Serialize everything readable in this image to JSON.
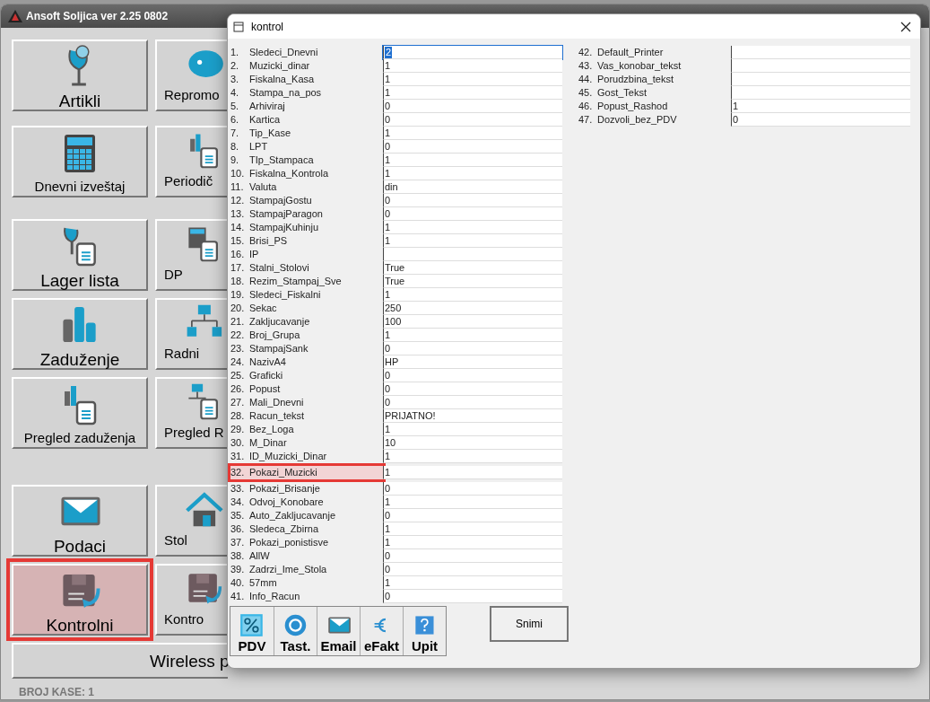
{
  "main_window": {
    "title": "Ansoft Soljica ver 2.25 0802",
    "buttons": [
      {
        "label": "Artikli",
        "highlighted": false
      },
      {
        "label": "Repromo",
        "highlighted": false
      },
      {
        "label": "Dnevni izveštaj",
        "highlighted": false
      },
      {
        "label": "Periodič",
        "highlighted": false
      },
      {
        "label": "Lager lista",
        "highlighted": false
      },
      {
        "label": "DP",
        "highlighted": false
      },
      {
        "label": "Zaduženje",
        "highlighted": false
      },
      {
        "label": "Radni",
        "highlighted": false
      },
      {
        "label": "Pregled zaduženja",
        "highlighted": false
      },
      {
        "label": "Pregled R",
        "highlighted": false
      },
      {
        "label": "Podaci",
        "highlighted": false
      },
      {
        "label": "Stol",
        "highlighted": false
      },
      {
        "label": "Kontrolni",
        "highlighted": true
      },
      {
        "label": "Kontro",
        "highlighted": false
      }
    ],
    "wide_button": "Wireless p",
    "status": "BROJ KASE: 1"
  },
  "dialog": {
    "title": "kontrol",
    "columns": [
      [
        {
          "number": "1.",
          "name": "Sledeci_Dnevni",
          "value": "2",
          "selected": true,
          "highlighted": false
        },
        {
          "number": "2.",
          "name": "Muzicki_dinar",
          "value": "1",
          "selected": false,
          "highlighted": false
        },
        {
          "number": "3.",
          "name": "Fiskalna_Kasa",
          "value": "1",
          "selected": false,
          "highlighted": false
        },
        {
          "number": "4.",
          "name": "Stampa_na_pos",
          "value": "1",
          "selected": false,
          "highlighted": false
        },
        {
          "number": "5.",
          "name": "Arhiviraj",
          "value": "0",
          "selected": false,
          "highlighted": false
        },
        {
          "number": "6.",
          "name": "Kartica",
          "value": "0",
          "selected": false,
          "highlighted": false
        },
        {
          "number": "7.",
          "name": "Tip_Kase",
          "value": "1",
          "selected": false,
          "highlighted": false
        },
        {
          "number": "8.",
          "name": "LPT",
          "value": "0",
          "selected": false,
          "highlighted": false
        },
        {
          "number": "9.",
          "name": "TIp_Stampaca",
          "value": "1",
          "selected": false,
          "highlighted": false
        },
        {
          "number": "10.",
          "name": "Fiskalna_Kontrola",
          "value": "1",
          "selected": false,
          "highlighted": false
        },
        {
          "number": "11.",
          "name": "Valuta",
          "value": "din",
          "selected": false,
          "highlighted": false
        },
        {
          "number": "12.",
          "name": "StampajGostu",
          "value": "0",
          "selected": false,
          "highlighted": false
        },
        {
          "number": "13.",
          "name": "StampajParagon",
          "value": "0",
          "selected": false,
          "highlighted": false
        },
        {
          "number": "14.",
          "name": "StampajKuhinju",
          "value": "1",
          "selected": false,
          "highlighted": false
        },
        {
          "number": "15.",
          "name": "Brisi_PS",
          "value": "1",
          "selected": false,
          "highlighted": false
        },
        {
          "number": "16.",
          "name": "IP",
          "selected": false,
          "highlighted": false
        },
        {
          "number": "17.",
          "name": "Stalni_Stolovi",
          "value": "True",
          "selected": false,
          "highlighted": false
        },
        {
          "number": "18.",
          "name": "Rezim_Stampaj_Sve",
          "value": "True",
          "selected": false,
          "highlighted": false
        },
        {
          "number": "19.",
          "name": "Sledeci_Fiskalni",
          "value": "1",
          "selected": false,
          "highlighted": false
        },
        {
          "number": "20.",
          "name": "Sekac",
          "value": "250",
          "selected": false,
          "highlighted": false
        },
        {
          "number": "21.",
          "name": "Zakljucavanje",
          "value": "100",
          "selected": false,
          "highlighted": false
        },
        {
          "number": "22.",
          "name": "Broj_Grupa",
          "value": "1",
          "selected": false,
          "highlighted": false
        },
        {
          "number": "23.",
          "name": "StampajSank",
          "value": "0",
          "selected": false,
          "highlighted": false
        },
        {
          "number": "24.",
          "name": "NazivA4",
          "value": "HP",
          "selected": false,
          "highlighted": false
        },
        {
          "number": "25.",
          "name": "Graficki",
          "value": "0",
          "selected": false,
          "highlighted": false
        },
        {
          "number": "26.",
          "name": "Popust",
          "value": "0",
          "selected": false,
          "highlighted": false
        },
        {
          "number": "27.",
          "name": "Mali_Dnevni",
          "value": "0",
          "selected": false,
          "highlighted": false
        },
        {
          "number": "28.",
          "name": "Racun_tekst",
          "value": "PRIJATNO!",
          "selected": false,
          "highlighted": false
        },
        {
          "number": "29.",
          "name": "Bez_Loga",
          "value": "1",
          "selected": false,
          "highlighted": false
        },
        {
          "number": "30.",
          "name": "M_Dinar",
          "value": "10",
          "selected": false,
          "highlighted": false
        },
        {
          "number": "31.",
          "name": "ID_Muzicki_Dinar",
          "value": "1",
          "selected": false,
          "highlighted": false
        },
        {
          "number": "32.",
          "name": "Pokazi_Muzicki",
          "value": "1",
          "selected": false,
          "highlighted": true
        },
        {
          "number": "33.",
          "name": "Pokazi_Brisanje",
          "value": "0",
          "selected": false,
          "highlighted": false
        },
        {
          "number": "34.",
          "name": "Odvoj_Konobare",
          "value": "1",
          "selected": false,
          "highlighted": false
        },
        {
          "number": "35.",
          "name": "Auto_Zakljucavanje",
          "value": "0",
          "selected": false,
          "highlighted": false
        },
        {
          "number": "36.",
          "name": "Sledeca_Zbirna",
          "value": "1",
          "selected": false,
          "highlighted": false
        },
        {
          "number": "37.",
          "name": "Pokazi_ponistisve",
          "value": "1",
          "selected": false,
          "highlighted": false
        },
        {
          "number": "38.",
          "name": "AllW",
          "value": "0",
          "selected": false,
          "highlighted": false
        },
        {
          "number": "39.",
          "name": "Zadrzi_Ime_Stola",
          "value": "0",
          "selected": false,
          "highlighted": false
        },
        {
          "number": "40.",
          "name": "57mm",
          "value": "1",
          "selected": false,
          "highlighted": false
        },
        {
          "number": "41.",
          "name": "Info_Racun",
          "value": "0",
          "selected": false,
          "highlighted": false
        }
      ],
      [
        {
          "number": "42.",
          "name": "Default_Printer",
          "selected": false,
          "highlighted": false
        },
        {
          "number": "43.",
          "name": "Vas_konobar_tekst",
          "selected": false,
          "highlighted": false
        },
        {
          "number": "44.",
          "name": "Porudzbina_tekst",
          "selected": false,
          "highlighted": false
        },
        {
          "number": "45.",
          "name": "Gost_Tekst",
          "selected": false,
          "highlighted": false
        },
        {
          "number": "46.",
          "name": "Popust_Rashod",
          "value": "1",
          "selected": false,
          "highlighted": false
        },
        {
          "number": "47.",
          "name": "Dozvoli_bez_PDV",
          "value": "0",
          "selected": false,
          "highlighted": false
        }
      ]
    ],
    "toolbar": [
      "PDV",
      "Tast.",
      "Email",
      "eFakt",
      "Upit"
    ],
    "save_button": "Snimi"
  }
}
